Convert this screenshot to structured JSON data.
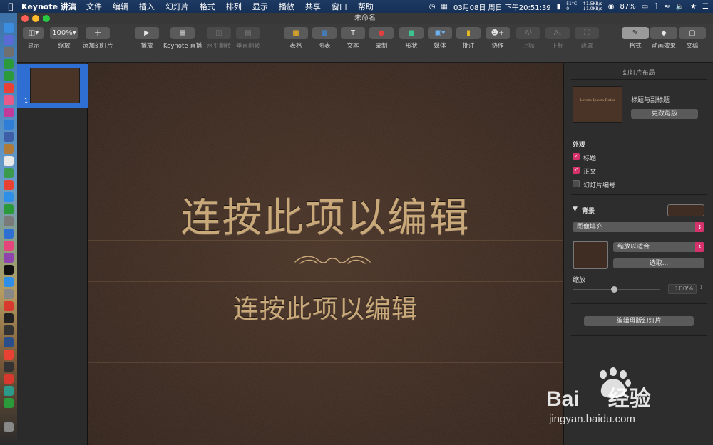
{
  "menubar": {
    "app_name": "Keynote 讲演",
    "menus": [
      "文件",
      "编辑",
      "插入",
      "幻灯片",
      "格式",
      "排列",
      "显示",
      "播放",
      "共享",
      "窗口",
      "帮助"
    ],
    "datetime": "03月08日 周日 下午20:51:39",
    "temp": "51°C",
    "temp2": "0",
    "net_up": "↑1.5KB/s",
    "net_down": "↓1.0KB/s",
    "battery": "87%"
  },
  "window": {
    "title": "未命名"
  },
  "toolbar": {
    "view_label": "显示",
    "zoom_value": "100%",
    "zoom_label": "缩放",
    "add_slide_label": "添加幻灯片",
    "play_label": "播放",
    "keynote_live_label": "Keynote 直播",
    "flip_h_label": "水平翻转",
    "flip_v_label": "垂直翻转",
    "table_label": "表格",
    "chart_label": "图表",
    "text_label": "文本",
    "record_label": "录制",
    "shape_label": "形状",
    "media_label": "媒体",
    "comment_label": "批注",
    "collab_label": "协作",
    "superscript_label": "上标",
    "subscript_label": "下标",
    "mask_label": "遮罩",
    "format_label": "格式",
    "animate_label": "动画效果",
    "document_label": "文稿"
  },
  "navigator": {
    "slide_number": "1"
  },
  "slide": {
    "title": "连按此项以编辑",
    "subtitle": "连按此项以编辑"
  },
  "inspector": {
    "header": "幻灯片布局",
    "master_name": "标题与副标题",
    "master_thumb_text": "Lorem Ipsum Dolor",
    "change_master": "更改母版",
    "appearance_title": "外观",
    "check_title": "标题",
    "check_body": "正文",
    "check_slide_number": "幻灯片编号",
    "background_title": "背景",
    "fill_type": "图像填充",
    "scale_mode": "缩放以适合",
    "choose": "选取...",
    "scale_label": "缩放",
    "scale_value": "100%",
    "edit_master": "编辑母版幻灯片"
  },
  "colors": {
    "accent": "#d6336c",
    "leather": "#3f2c22",
    "gold_text": "#c9a97a"
  },
  "watermark": {
    "brand": "Bai",
    "brand_cn": "经验",
    "url": "jingyan.baidu.com"
  }
}
